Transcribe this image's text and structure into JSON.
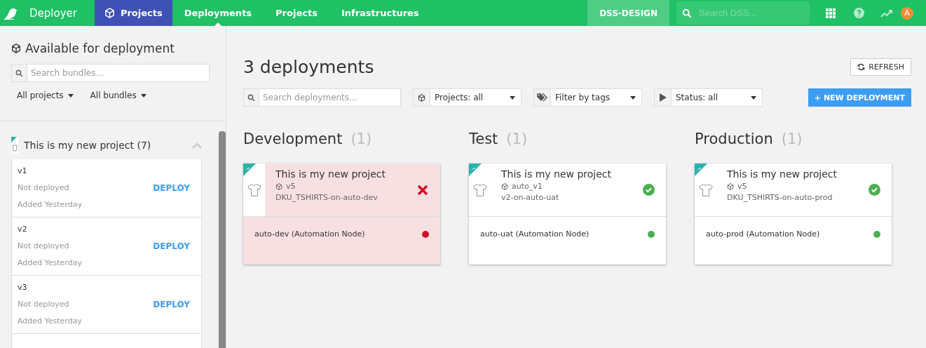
{
  "nav": {
    "brand": "Deployer",
    "items": [
      {
        "label": "Projects",
        "selected": true,
        "kind": "home",
        "current": false
      },
      {
        "label": "Deployments",
        "selected": false,
        "kind": "link",
        "current": true
      },
      {
        "label": "Projects",
        "selected": false,
        "kind": "link",
        "current": false
      },
      {
        "label": "Infrastructures",
        "selected": false,
        "kind": "link",
        "current": false
      }
    ],
    "instance": "DSS-DESIGN",
    "search": {
      "placeholder": "Search DSS..."
    },
    "avatar": "A"
  },
  "sidebar": {
    "title": "Available for deployment",
    "search": {
      "placeholder": "Search bundles..."
    },
    "filters": [
      "All projects",
      "All bundles"
    ],
    "project": {
      "name": "This is my new project (7)",
      "expanded": true,
      "bundles": [
        {
          "name": "v1",
          "status": "Not deployed",
          "added": "Added Yesterday",
          "action": "DEPLOY"
        },
        {
          "name": "v2",
          "status": "Not deployed",
          "added": "Added Yesterday",
          "action": "DEPLOY"
        },
        {
          "name": "v3",
          "status": "Not deployed",
          "added": "Added Yesterday",
          "action": "DEPLOY"
        }
      ]
    }
  },
  "main": {
    "title": "3 deployments",
    "refresh": "REFRESH",
    "search": {
      "placeholder": "Search deployments..."
    },
    "filters": [
      {
        "kind": "projects",
        "value": "Projects: all"
      },
      {
        "kind": "tags",
        "value": "Filter by tags"
      },
      {
        "kind": "status",
        "value": "Status: all"
      }
    ],
    "new_button": "+ NEW DEPLOYMENT",
    "stages": [
      {
        "name": "Development",
        "count": "(1)",
        "deployments": [
          {
            "project": "This is my new project",
            "bundle": "v5",
            "id": "DKU_TSHIRTS-on-auto-dev",
            "failed": true,
            "node": "auto-dev (Automation Node)",
            "color": "#d0112b"
          }
        ]
      },
      {
        "name": "Test",
        "count": "(1)",
        "deployments": [
          {
            "project": "This is my new project",
            "bundle": "auto_v1",
            "id": "v2-on-auto-uat",
            "failed": false,
            "node": "auto-uat (Automation Node)",
            "color": "#4caf50"
          }
        ]
      },
      {
        "name": "Production",
        "count": "(1)",
        "deployments": [
          {
            "project": "This is my new project",
            "bundle": "v5",
            "id": "DKU_TSHIRTS-on-auto-prod",
            "failed": false,
            "node": "auto-prod (Automation Node)",
            "color": "#4caf50"
          }
        ]
      }
    ]
  }
}
